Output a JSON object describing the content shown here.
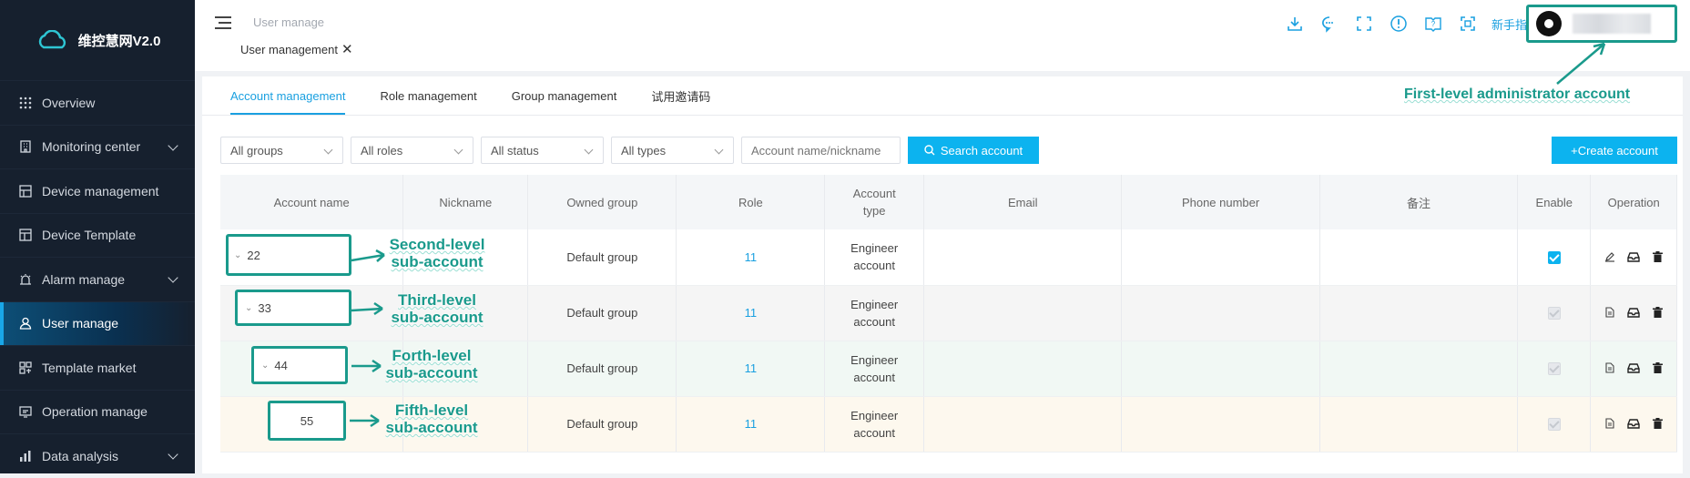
{
  "brand": {
    "name": "维控慧网V2.0"
  },
  "sidebar": {
    "items": [
      {
        "label": "Overview",
        "icon": "grid-icon",
        "expandable": false
      },
      {
        "label": "Monitoring center",
        "icon": "building-icon",
        "expandable": true
      },
      {
        "label": "Device management",
        "icon": "device-icon",
        "expandable": false
      },
      {
        "label": "Device Template",
        "icon": "template-icon",
        "expandable": false
      },
      {
        "label": "Alarm manage",
        "icon": "alarm-icon",
        "expandable": true
      },
      {
        "label": "User manage",
        "icon": "user-icon",
        "expandable": false,
        "active": true
      },
      {
        "label": "Template market",
        "icon": "market-icon",
        "expandable": false
      },
      {
        "label": "Operation manage",
        "icon": "operation-icon",
        "expandable": false
      },
      {
        "label": "Data analysis",
        "icon": "chart-icon",
        "expandable": true
      }
    ]
  },
  "header": {
    "breadcrumb": "User manage",
    "open_tag": "User management",
    "guide_label": "新手指引",
    "tool_icons": [
      "download-icon",
      "message-icon",
      "fullscreen-icon",
      "alert-icon",
      "help-book-icon",
      "scan-icon"
    ]
  },
  "tabs": [
    "Account management",
    "Role management",
    "Group management",
    "试用邀请码"
  ],
  "filters": {
    "group": "All groups",
    "role": "All roles",
    "status": "All status",
    "type": "All types",
    "search_placeholder": "Account name/nickname",
    "search_button": "Search account",
    "create_button": "Create account"
  },
  "table": {
    "columns": [
      "Account name",
      "Nickname",
      "Owned group",
      "Role",
      "Account type",
      "Email",
      "Phone number",
      "备注",
      "Enable",
      "Operation"
    ],
    "rows": [
      {
        "account": "22",
        "nickname": "",
        "group": "Default group",
        "role": "11",
        "type": "Engineer account",
        "email": "",
        "phone": "",
        "note": "",
        "enable": "checked"
      },
      {
        "account": "33",
        "nickname": "",
        "group": "Default group",
        "role": "11",
        "type": "Engineer account",
        "email": "",
        "phone": "",
        "note": "",
        "enable": "disabled"
      },
      {
        "account": "44",
        "nickname": "",
        "group": "Default group",
        "role": "11",
        "type": "Engineer account",
        "email": "",
        "phone": "",
        "note": "",
        "enable": "disabled"
      },
      {
        "account": "55",
        "nickname": "",
        "group": "Default group",
        "role": "11",
        "type": "Engineer account",
        "email": "",
        "phone": "",
        "note": "",
        "enable": "disabled"
      }
    ]
  },
  "annotations": {
    "first_level": "First-level administrator account",
    "second_level": [
      "Second-level",
      "sub-account"
    ],
    "third_level": [
      "Third-level",
      "sub-account"
    ],
    "fourth_level": [
      "Forth-level",
      "sub-account"
    ],
    "fifth_level": [
      "Fifth-level",
      "sub-account"
    ],
    "color": "#1a9a8c"
  },
  "colors": {
    "accent": "#0cb3ef",
    "sidebar_bg": "#16202e",
    "annotation": "#1a9a8c"
  }
}
